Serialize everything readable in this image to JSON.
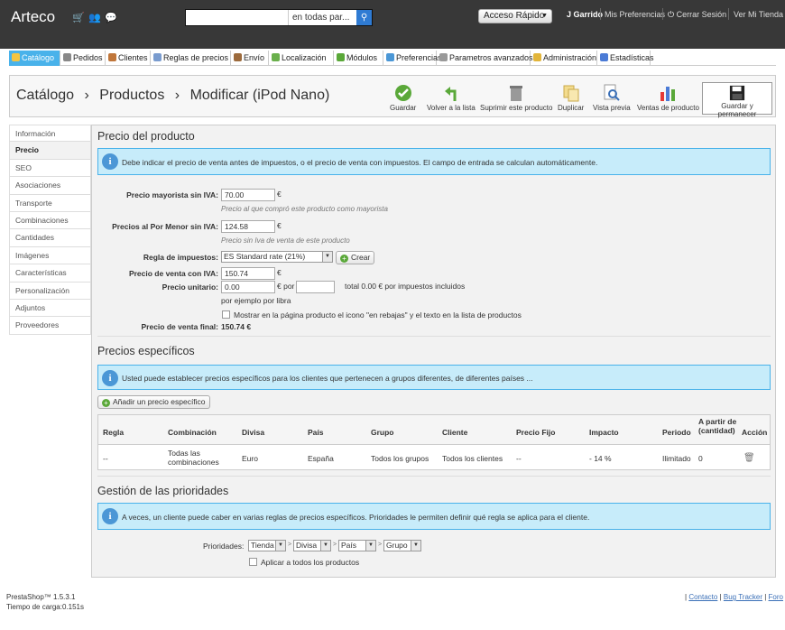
{
  "topbar": {
    "logo": "Arteco",
    "search_placeholder": "",
    "search_scope": "en todas par...",
    "quick_access": "Acceso Rápido",
    "user": "J Garrido",
    "preferences": "Mis Preferencias",
    "logout": "Cerrar Sesión",
    "view_store": "Ver Mi Tienda"
  },
  "tabs": [
    {
      "label": "Catálogo",
      "icon": "folder-icon",
      "color": "#f5c542"
    },
    {
      "label": "Pedidos",
      "icon": "orders-icon",
      "color": "#888888"
    },
    {
      "label": "Clientes",
      "icon": "customers-icon",
      "color": "#c0763a"
    },
    {
      "label": "Reglas de precios",
      "icon": "price-rules-icon",
      "color": "#7a9ccf"
    },
    {
      "label": "Envío",
      "icon": "shipping-icon",
      "color": "#9c6a3c"
    },
    {
      "label": "Localización",
      "icon": "globe-icon",
      "color": "#6ab04c"
    },
    {
      "label": "Módulos",
      "icon": "puzzle-icon",
      "color": "#5aa839"
    },
    {
      "label": "Preferencias",
      "icon": "preferences-icon",
      "color": "#4b97d6"
    },
    {
      "label": "Parametros avanzados",
      "icon": "wrench-icon",
      "color": "#999999"
    },
    {
      "label": "Administración",
      "icon": "key-icon",
      "color": "#e2b53b"
    },
    {
      "label": "Estadísticas",
      "icon": "stats-icon",
      "color": "#4b7bd6"
    }
  ],
  "header": {
    "crumbs": [
      "Catálogo",
      "Productos",
      "Modificar (iPod Nano)"
    ],
    "toolbar": [
      "Guardar",
      "Volver a la lista",
      "Suprimir este producto",
      "Duplicar",
      "Vista previa",
      "Ventas de producto"
    ],
    "save_stay": "Guardar y permanecer"
  },
  "sidebar": [
    "Información",
    "Precio",
    "SEO",
    "Asociaciones",
    "Transporte",
    "Combinaciones",
    "Cantidades",
    "Imágenes",
    "Características",
    "Personalización",
    "Adjuntos",
    "Proveedores"
  ],
  "price": {
    "title": "Precio del producto",
    "info": "Debe indicar el precio de venta antes de impuestos, o el precio de venta con impuestos. El campo de entrada se calculan automáticamente.",
    "wholesale_label": "Precio mayorista sin IVA:",
    "wholesale_value": "70.00",
    "wholesale_hint": "Precio al que compró este producto como mayorista",
    "retail_label": "Precios al Por Menor sin IVA:",
    "retail_value": "124.58",
    "retail_hint": "Precio sin Iva de venta de este producto",
    "tax_label": "Regla de impuestos:",
    "tax_value": "ES Standard rate (21%)",
    "create_button": "Crear",
    "with_tax_label": "Precio de venta con IVA:",
    "with_tax_value": "150.74",
    "unit_label": "Precio unitario:",
    "unit_value": "0.00",
    "unit_per": "€ por",
    "unit_total": "total 0.00 € por impuestos incluidos",
    "unit_hint": "por ejemplo por libra",
    "sale_checkbox": "Mostrar en la página producto el icono \"en rebajas\" y el texto en la lista de productos",
    "final_label": "Precio de venta final:",
    "final_value": "150.74 €",
    "euro": "€"
  },
  "specific": {
    "title": "Precios específicos",
    "info": "Usted puede establecer precios específicos para los clientes que pertenecen a grupos diferentes, de diferentes países ...",
    "add_button": "Añadir un precio específico",
    "headers": [
      "Regla",
      "Combinación",
      "Divisa",
      "País",
      "Grupo",
      "Cliente",
      "Precio Fijo",
      "Impacto",
      "Periodo",
      "A partir de (cantidad)",
      "Acción"
    ],
    "row": [
      "--",
      "Todas las combinaciones",
      "Euro",
      "España",
      "Todos los grupos",
      "Todos los clientes",
      "--",
      "- 14 %",
      "Ilimitado",
      "0"
    ]
  },
  "priority": {
    "title": "Gestión de las prioridades",
    "info": "A veces, un cliente puede caber en varias reglas de precios específicos. Prioridades le permiten definir qué regla se aplica para el cliente.",
    "label": "Prioridades:",
    "selects": [
      "Tienda",
      "Divisa",
      "País",
      "Grupo"
    ],
    "apply_all": "Aplicar a todos los productos"
  },
  "footer": {
    "version": "PrestaShop™ 1.5.3.1",
    "load_time": "Tiempo de carga:0.151s",
    "links": [
      "Contacto",
      "Bug Tracker",
      "Foro"
    ]
  }
}
